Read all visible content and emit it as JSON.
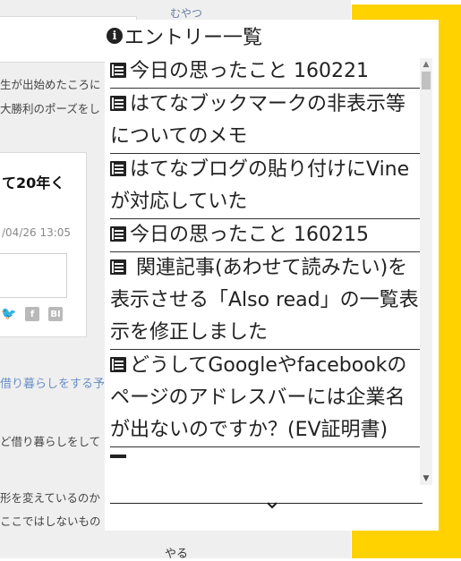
{
  "background": {
    "header_label": "むやつ",
    "line_1": "生が出始めたころに",
    "line_2": "大勝利のポーズをし",
    "card_title": "て20年く",
    "card_date": "/04/26 13:05",
    "share_fb": "f",
    "share_bi": "BI",
    "link_text": "借り暮らしをする予",
    "line_3": "ど借り暮らしをして",
    "line_4": "形を変えているのか",
    "line_5": "ここではしないもの",
    "footer_label": "やる"
  },
  "panel": {
    "title": "エントリー一覧",
    "entries": [
      {
        "label": "今日の思ったこと 160221"
      },
      {
        "label": "はてなブックマークの非表示等についてのメモ"
      },
      {
        "label": "はてなブログの貼り付けにVineが対応していた"
      },
      {
        "label": "今日の思ったこと 160215"
      },
      {
        "label": " 関連記事(あわせて読みたい)を表示させる「Also read」の一覧表示を修正しました"
      },
      {
        "label": "どうしてGoogleやfacebookのページのアドレスバーには企業名が出ないのですか？(EV証明書)"
      }
    ]
  },
  "colors": {
    "accent_yellow": "#ffd200",
    "link_blue": "#6a8fc4"
  }
}
